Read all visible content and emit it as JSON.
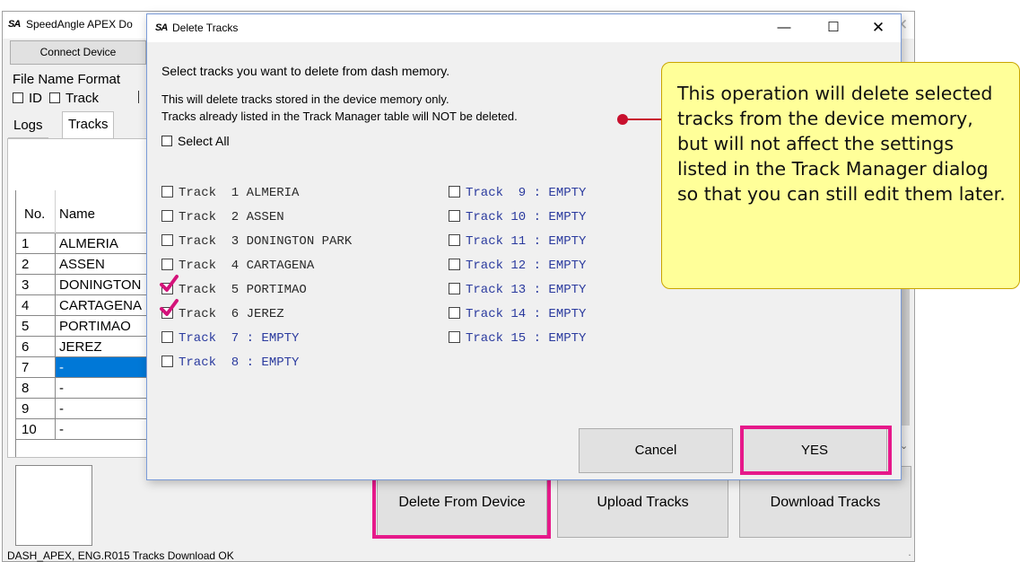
{
  "main_window": {
    "title": "SpeedAngle APEX Do",
    "logo_text": "SA",
    "connect_label": "Connect Device",
    "file_name_format_label": "File Name Format",
    "options": [
      {
        "label": "ID",
        "checked": false
      },
      {
        "label": "Track",
        "checked": false
      }
    ],
    "tabs": [
      "Logs",
      "Tracks"
    ],
    "active_tab": "Tracks",
    "table": {
      "headers": {
        "no": "No.",
        "name": "Name"
      },
      "rows": [
        {
          "no": "1",
          "name": "ALMERIA"
        },
        {
          "no": "2",
          "name": "ASSEN"
        },
        {
          "no": "3",
          "name": "DONINGTON"
        },
        {
          "no": "4",
          "name": "CARTAGENA"
        },
        {
          "no": "5",
          "name": "PORTIMAO"
        },
        {
          "no": "6",
          "name": "JEREZ"
        },
        {
          "no": "7",
          "name": "-"
        },
        {
          "no": "8",
          "name": "-"
        },
        {
          "no": "9",
          "name": "-"
        },
        {
          "no": "10",
          "name": "-"
        }
      ],
      "selected_row": "7"
    },
    "buttons": {
      "delete_from_device": "Delete From Device",
      "upload_tracks": "Upload Tracks",
      "download_tracks": "Download Tracks"
    },
    "status_text": "DASH_APEX, ENG.R015  Tracks Download OK"
  },
  "dialog": {
    "title": "Delete Tracks",
    "logo_text": "SA",
    "controls": {
      "minimize": "—",
      "maximize": "☐",
      "close": "✕"
    },
    "instruction": "Select tracks you want to delete from dash memory.",
    "note_line1": "This will delete tracks stored in the device memory only.",
    "note_line2": "Tracks already listed in the Track Manager table will NOT be deleted.",
    "select_all_label": "Select All",
    "tracks_col1": [
      {
        "label": "Track  1 ALMERIA",
        "checked": false,
        "empty": false
      },
      {
        "label": "Track  2 ASSEN",
        "checked": false,
        "empty": false
      },
      {
        "label": "Track  3 DONINGTON PARK",
        "checked": false,
        "empty": false
      },
      {
        "label": "Track  4 CARTAGENA",
        "checked": false,
        "empty": false
      },
      {
        "label": "Track  5 PORTIMAO",
        "checked": true,
        "empty": false
      },
      {
        "label": "Track  6 JEREZ",
        "checked": true,
        "empty": false
      },
      {
        "label": "Track  7 : EMPTY",
        "checked": false,
        "empty": true
      },
      {
        "label": "Track  8 : EMPTY",
        "checked": false,
        "empty": true
      }
    ],
    "tracks_col2": [
      {
        "label": "Track  9 : EMPTY",
        "checked": false,
        "empty": true
      },
      {
        "label": "Track 10 : EMPTY",
        "checked": false,
        "empty": true
      },
      {
        "label": "Track 11 : EMPTY",
        "checked": false,
        "empty": true
      },
      {
        "label": "Track 12 : EMPTY",
        "checked": false,
        "empty": true
      },
      {
        "label": "Track 13 : EMPTY",
        "checked": false,
        "empty": true
      },
      {
        "label": "Track 14 : EMPTY",
        "checked": false,
        "empty": true
      },
      {
        "label": "Track 15 : EMPTY",
        "checked": false,
        "empty": true
      }
    ],
    "cancel_label": "Cancel",
    "yes_label": "YES"
  },
  "callout": {
    "text": "This operation will delete selected tracks from the device memory, but will not affect the settings listed in the Track Manager dialog so that you can still edit them later."
  },
  "colors": {
    "highlight": "#e6198a",
    "selection": "#0078d7",
    "empty_track_text": "#2a3a9e",
    "callout_bg": "#ffff99",
    "callout_pointer": "#c8102e",
    "checkmark": "#d4137a"
  }
}
